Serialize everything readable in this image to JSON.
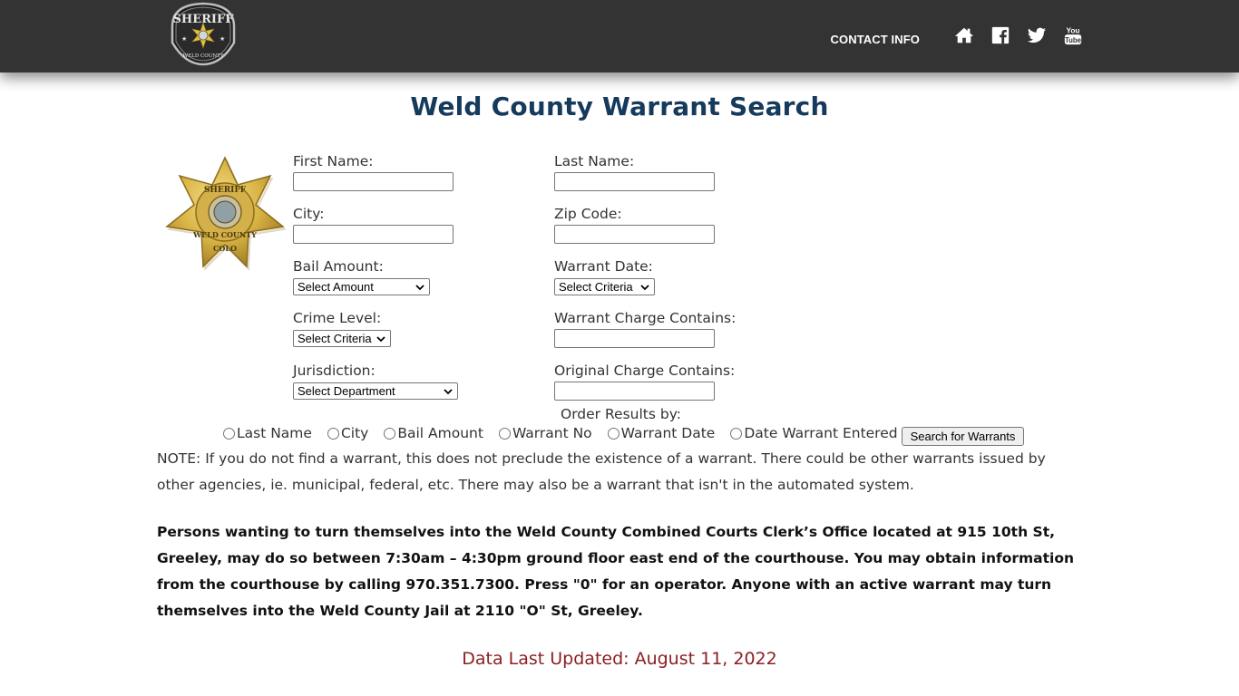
{
  "header": {
    "logo_text_top": "SHERIFF",
    "logo_text_bottom": "WELD COUNTY",
    "nav_contact": "CONTACT INFO",
    "nav_icons": [
      "home-icon",
      "facebook-icon",
      "twitter-icon",
      "youtube-icon"
    ],
    "background_color": "#333333"
  },
  "page": {
    "title": "Weld County Warrant Search",
    "title_color": "#163a5c"
  },
  "badge": {
    "line1": "SHERIFF",
    "line2": "WELD COUNTY",
    "line3": "COLO"
  },
  "form": {
    "first_name": {
      "label": "First Name:",
      "value": "",
      "placeholder": ""
    },
    "last_name": {
      "label": "Last Name:",
      "value": "",
      "placeholder": ""
    },
    "city": {
      "label": "City:",
      "value": "",
      "placeholder": ""
    },
    "zip_code": {
      "label": "Zip Code:",
      "value": "",
      "placeholder": ""
    },
    "bail_amount": {
      "label": "Bail Amount:",
      "selected": "Select Amount"
    },
    "warrant_date": {
      "label": "Warrant Date:",
      "selected": "Select Criteria"
    },
    "crime_level": {
      "label": "Crime Level:",
      "selected": "Select Criteria"
    },
    "warrant_charge": {
      "label": "Warrant Charge Contains:",
      "value": ""
    },
    "jurisdiction": {
      "label": "Jurisdiction:",
      "selected": "Select Department"
    },
    "original_charge": {
      "label": "Original Charge Contains:",
      "value": ""
    },
    "order_by": {
      "label": "Order Results by:",
      "options": [
        "Last Name",
        "City",
        "Bail Amount",
        "Warrant No",
        "Warrant Date",
        "Date Warrant Entered"
      ],
      "selected": null
    },
    "search_button": "Search for Warrants"
  },
  "notes": {
    "note": "NOTE: If you do not find a warrant, this does not preclude the existence of a warrant. There could be other warrants issued by other agencies, ie. municipal, federal, etc. There may also be a warrant that isn't in the automated system.",
    "surrender_info": "Persons wanting to turn themselves into the Weld County Combined Courts Clerk’s Office located at 915 10th St, Greeley, may do so between 7:30am – 4:30pm ground floor east end of the courthouse. You may obtain information from the courthouse by calling 970.351.7300. Press \"0\" for an operator. Anyone with an active warrant may turn themselves into the Weld County Jail at 2110 \"O\" St, Greeley.",
    "last_updated": "Data Last Updated: August 11, 2022",
    "last_updated_color": "#8b1f22"
  }
}
